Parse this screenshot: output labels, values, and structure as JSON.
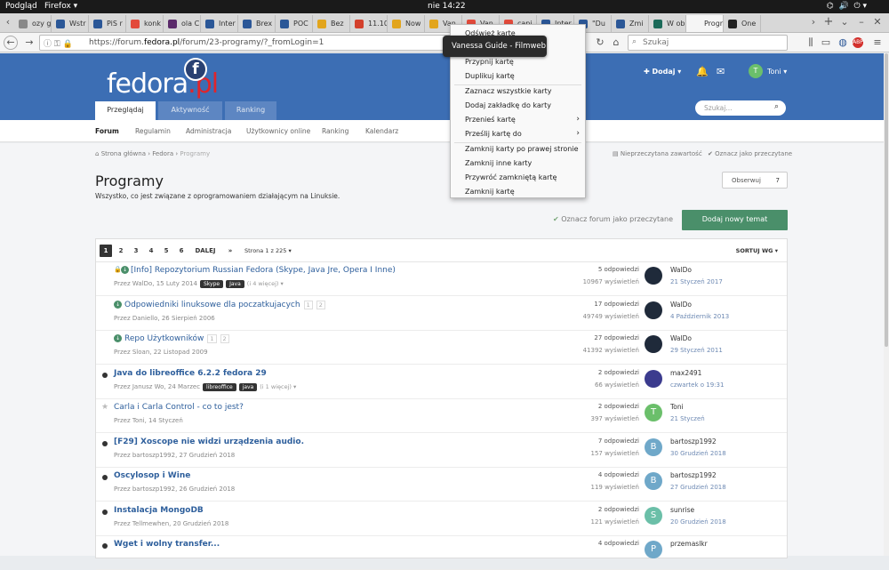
{
  "system": {
    "app_menu": "Podgląd",
    "browser_menu": "Firefox",
    "clock": "nie 14:22"
  },
  "tabs": [
    {
      "label": "ozy g",
      "icon": "generic-tab-icon",
      "color": "#888"
    },
    {
      "label": "Wstr",
      "icon": "nt-tab-icon",
      "color": "#2b5797"
    },
    {
      "label": "PiS r",
      "icon": "nt-tab-icon",
      "color": "#2b5797"
    },
    {
      "label": "konk",
      "icon": "google-tab-icon",
      "color": "#e24a3b"
    },
    {
      "label": "ola C",
      "icon": "square-tab-icon",
      "color": "#5a2a6a"
    },
    {
      "label": "Inter",
      "icon": "nt-tab-icon",
      "color": "#2b5797"
    },
    {
      "label": "Brex",
      "icon": "nt-tab-icon",
      "color": "#2b5797"
    },
    {
      "label": "POC",
      "icon": "nt-tab-icon",
      "color": "#2b5797"
    },
    {
      "label": "Bez",
      "icon": "smiley-tab-icon",
      "color": "#e2a51d"
    },
    {
      "label": "11.10",
      "icon": "red-tab-icon",
      "color": "#d3402c"
    },
    {
      "label": "Now",
      "icon": "smiley-tab-icon",
      "color": "#e2a51d"
    },
    {
      "label": "Van",
      "icon": "smiley-tab-icon",
      "color": "#e2a51d"
    },
    {
      "label": "Van",
      "icon": "google-tab-icon",
      "color": "#e24a3b"
    },
    {
      "label": "capi",
      "icon": "google-tab-icon",
      "color": "#e24a3b"
    },
    {
      "label": "Inter",
      "icon": "nt-tab-icon",
      "color": "#2b5797"
    },
    {
      "label": "\"Du",
      "icon": "nt-tab-icon",
      "color": "#2b5797"
    },
    {
      "label": "Zmi",
      "icon": "nt-tab-icon",
      "color": "#2b5797"
    },
    {
      "label": "W ob",
      "icon": "person-tab-icon",
      "color": "#1b6a59"
    },
    {
      "label": "Progr",
      "icon": "none",
      "color": "#f5f5f5"
    },
    {
      "label": "One",
      "icon": "onet-tab-icon",
      "color": "#222"
    }
  ],
  "nav": {
    "url_host": "https://forum.",
    "url_domain": "fedora.pl",
    "url_path": "/forum/23-programy/?_fromLogin=1",
    "search_placeholder": "Szukaj"
  },
  "tooltip": "Vanessa Guide - Filmweb",
  "context_menu": [
    "Odśwież kartę",
    "Przypnij kartę",
    "Duplikuj kartę",
    "Zaznacz wszystkie karty",
    "Dodaj zakładkę do karty",
    "Przenieś kartę",
    "Prześlij kartę do",
    "Zamknij karty po prawej stronie",
    "Zamknij inne karty",
    "Przywróć zamkniętą kartę",
    "Zamknij kartę"
  ],
  "site": {
    "logo_main": "fedora",
    "logo_pl": ".pl",
    "logo_badge": "f",
    "tabs": [
      "Przeglądaj",
      "Aktywność",
      "Ranking"
    ],
    "add_label": "Dodaj",
    "user_initial": "T",
    "user_name": "Toni",
    "search_placeholder": "Szukaj...",
    "subnav": [
      "Forum",
      "Regulamin",
      "Administracja",
      "Użytkownicy online",
      "Ranking",
      "Kalendarz"
    ]
  },
  "breadcrumb": {
    "home": "Strona główna",
    "sep1": "›",
    "cat": "Fedora",
    "sep2": "›",
    "current": "Programy"
  },
  "actions": {
    "unread": "Nieprzeczytana zawartość",
    "mark_read": "Oznacz jako przeczytane",
    "follow": "Obserwuj",
    "follow_count": "7",
    "mark_forum": "Oznacz forum jako przeczytane",
    "new_topic": "Dodaj nowy temat"
  },
  "page": {
    "title": "Programy",
    "description": "Wszystko, co jest związane z oprogramowaniem działającym na Linuksie."
  },
  "pager": {
    "pages": [
      "1",
      "2",
      "3",
      "4",
      "5",
      "6"
    ],
    "next": "DALEJ",
    "last": "»",
    "info": "Strona 1 z 225",
    "sort": "SORTUJ WG"
  },
  "topics": [
    {
      "title": "[Info] Repozytorium Russian Fedora (Skype, Java Jre, Opera I Inne)",
      "meta": "Przez WalDo, 15 Luty 2014",
      "tags": [
        "Skype",
        "Java"
      ],
      "more": "(i 4 więcej)",
      "pages": "",
      "replies": "5 odpowiedzi",
      "views": "10967 wyświetleń",
      "last_user": "WalDo",
      "last_date": "21 Styczeń 2017",
      "avatar": "",
      "av_color": "#1f2a3a",
      "state": "pinned-locked",
      "bold": false
    },
    {
      "title": "Odpowiedniki linuksowe dla poczatkujacych",
      "meta": "Przez Daniello, 26 Sierpień 2006",
      "tags": [],
      "more": "",
      "pages": "1 2",
      "replies": "17 odpowiedzi",
      "views": "49749 wyświetleń",
      "last_user": "WalDo",
      "last_date": "4 Październik 2013",
      "avatar": "",
      "av_color": "#1f2a3a",
      "state": "pinned",
      "bold": false
    },
    {
      "title": "Repo Użytkowników",
      "meta": "Przez Sloan, 22 Listopad 2009",
      "tags": [],
      "more": "",
      "pages": "1 2",
      "replies": "27 odpowiedzi",
      "views": "41392 wyświetleń",
      "last_user": "WalDo",
      "last_date": "29 Styczeń 2011",
      "avatar": "",
      "av_color": "#1f2a3a",
      "state": "pinned",
      "bold": false
    },
    {
      "title": "Java do libreoffice 6.2.2 fedora 29",
      "meta": "Przez Janusz Wo, 24 Marzec",
      "tags": [
        "libreoffice",
        "java"
      ],
      "more": "(i 1 więcej)",
      "pages": "",
      "replies": "2 odpowiedzi",
      "views": "66 wyświetleń",
      "last_user": "max2491",
      "last_date": "czwartek o 19:31",
      "avatar": "",
      "av_color": "#3b3b8e",
      "state": "unread",
      "bold": true
    },
    {
      "title": "Carla i Carla Control - co to jest?",
      "meta": "Przez Toni, 14 Styczeń",
      "tags": [],
      "more": "",
      "pages": "",
      "replies": "2 odpowiedzi",
      "views": "397 wyświetleń",
      "last_user": "Toni",
      "last_date": "21 Styczeń",
      "avatar": "T",
      "av_color": "#6bbf6b",
      "state": "read",
      "bold": false
    },
    {
      "title": "[F29] Xoscope nie widzi urządzenia audio.",
      "meta": "Przez bartoszp1992, 27 Grudzień 2018",
      "tags": [],
      "more": "",
      "pages": "",
      "replies": "7 odpowiedzi",
      "views": "157 wyświetleń",
      "last_user": "bartoszp1992",
      "last_date": "30 Grudzień 2018",
      "avatar": "B",
      "av_color": "#6fa8c9",
      "state": "unread",
      "bold": true
    },
    {
      "title": "Oscylosop i Wine",
      "meta": "Przez bartoszp1992, 26 Grudzień 2018",
      "tags": [],
      "more": "",
      "pages": "",
      "replies": "4 odpowiedzi",
      "views": "119 wyświetleń",
      "last_user": "bartoszp1992",
      "last_date": "27 Grudzień 2018",
      "avatar": "B",
      "av_color": "#6fa8c9",
      "state": "unread",
      "bold": true
    },
    {
      "title": "Instalacja MongoDB",
      "meta": "Przez Tellmewhen, 20 Grudzień 2018",
      "tags": [],
      "more": "",
      "pages": "",
      "replies": "2 odpowiedzi",
      "views": "121 wyświetleń",
      "last_user": "sunrise",
      "last_date": "20 Grudzień 2018",
      "avatar": "S",
      "av_color": "#6bbfa8",
      "state": "unread",
      "bold": true
    },
    {
      "title": "Wget i wolny transfer...",
      "meta": "",
      "tags": [],
      "more": "",
      "pages": "",
      "replies": "4 odpowiedzi",
      "views": "",
      "last_user": "przemaslkr",
      "last_date": "",
      "avatar": "P",
      "av_color": "#6fa8c9",
      "state": "unread",
      "bold": true
    }
  ]
}
